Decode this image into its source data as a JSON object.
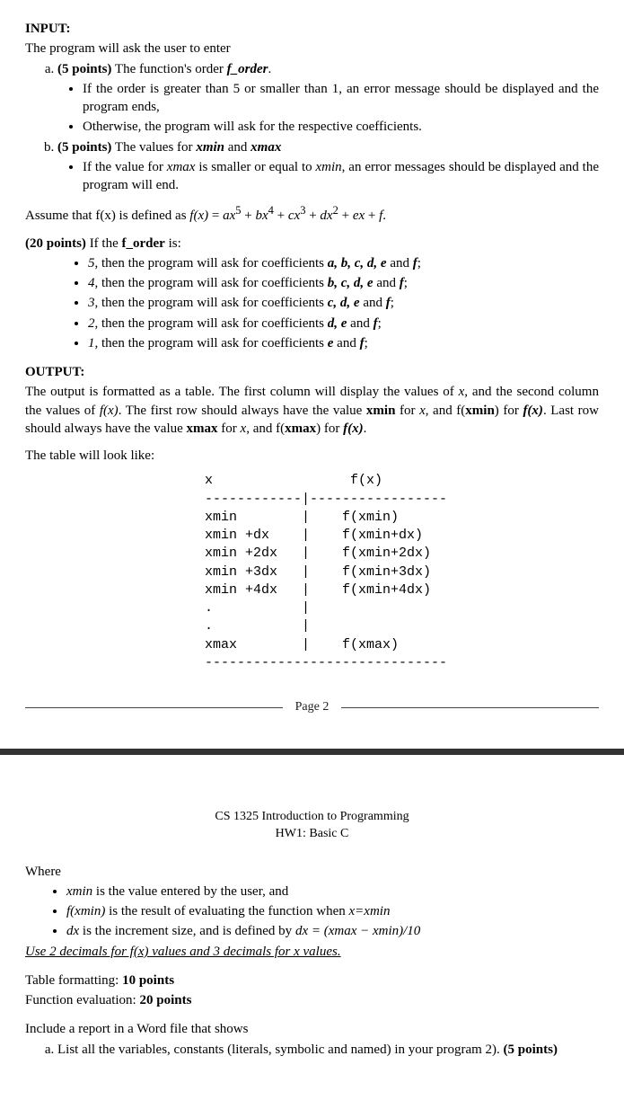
{
  "input": {
    "heading": "INPUT:",
    "intro": "The program will ask the user to enter",
    "a": {
      "prefix": "(5 points)",
      "text_before": " The function's order ",
      "term": "f_order",
      "text_after": ".",
      "bullets": [
        "If the order is greater than 5 or smaller than 1, an error message should be displayed and the program ends,",
        "Otherwise, the program will ask for the respective coefficients."
      ]
    },
    "b": {
      "prefix": "(5 points)",
      "text_before": " The values for ",
      "xmin": "xmin",
      "and": " and ",
      "xmax": "xmax",
      "bullets_parts": {
        "t1": "If the value for ",
        "t2": "xmax",
        "t3": " is smaller or equal to ",
        "t4": "xmin",
        "t5": ", an error messages should be displayed and the program will end."
      }
    },
    "assume": {
      "t1": "Assume that f(x) is defined as ",
      "fx": "f(x)",
      "eq": " = ",
      "a": "ax",
      "p5": "5",
      "plus": " + ",
      "b": "bx",
      "p4": "4",
      "c": "cx",
      "p3": "3",
      "d": "dx",
      "p2": "2",
      "e": "ex",
      "f": "f",
      "dot": "."
    },
    "twenty": {
      "prefix": "(20 points)",
      "text": " If the ",
      "term": "f_order",
      "after": " is:",
      "rows": [
        {
          "n": "5",
          "mid": ", then the program will ask for coefficients ",
          "coeffs": "a, b, c, d, e",
          "and": " and ",
          "last": "f",
          "end": ";"
        },
        {
          "n": "4",
          "mid": ", then the program will ask for coefficients ",
          "coeffs": "b, c, d, e",
          "and": " and ",
          "last": "f",
          "end": ";"
        },
        {
          "n": "3",
          "mid": ", then the program will ask for coefficients ",
          "coeffs": "c, d, e",
          "and": " and ",
          "last": "f",
          "end": ";"
        },
        {
          "n": "2",
          "mid": ", then the program will ask for coefficients ",
          "coeffs": "d, e",
          "and": " and ",
          "last": "f",
          "end": ";"
        },
        {
          "n": "1",
          "mid": ", then the program will ask for coefficients ",
          "coeffs": "e",
          "and": " and ",
          "last": "f",
          "end": ";"
        }
      ]
    }
  },
  "output": {
    "heading": "OUTPUT:",
    "para_parts": {
      "t1": "The output is formatted as a table. The first column will display the values of ",
      "x": "x",
      "t2": ", and the second column the values of ",
      "fx": "f(x)",
      "t3": ". The first row should always have the value ",
      "xmin": "xmin",
      "t4": " for ",
      "x2": "x",
      "t5": ", and f(",
      "xminb": "xmin",
      "t6": ") for ",
      "fx2": "f(x)",
      "t7": ". Last row should always have the value ",
      "xmax": "xmax",
      "t8": " for ",
      "x3": "x",
      "t9": ", and f(",
      "xmaxb": "xmax",
      "t10": ") for ",
      "fx3": "f(x)",
      "t11": "."
    },
    "look": "The table will look like:",
    "tabletext": "x                 f(x)\n------------|-----------------\nxmin        |    f(xmin)\nxmin +dx    |    f(xmin+dx)\nxmin +2dx   |    f(xmin+2dx)\nxmin +3dx   |    f(xmin+3dx)\nxmin +4dx   |    f(xmin+4dx)\n.           |\n.           |\nxmax        |    f(xmax)\n------------------------------"
  },
  "pagebreak": {
    "label": "Page 2"
  },
  "header2": {
    "course": "CS 1325 Introduction to Programming",
    "hw": "HW1: Basic C"
  },
  "where": {
    "heading": "Where",
    "b1": {
      "xmin": "xmin",
      "rest": " is the value entered by the user, and"
    },
    "b2": {
      "fx": "f(xmin)",
      "mid": " is the result of evaluating the function when ",
      "eq": "x=xmin"
    },
    "b3": {
      "dx": "dx",
      "mid": " is the increment size, and is defined by ",
      "eq": "dx = (xmax − xmin)/10"
    },
    "note": "Use 2 decimals for f(x) values and 3 decimals for x values."
  },
  "grading": {
    "line1a": "Table formatting: ",
    "line1b": "10 points",
    "line2a": "Function evaluation: ",
    "line2b": "20 points"
  },
  "report": {
    "intro": "Include a report in a Word file that shows",
    "a": {
      "text": "List all the variables, constants (literals, symbolic and named) in your program 2). ",
      "pts": "(5 points)"
    }
  }
}
